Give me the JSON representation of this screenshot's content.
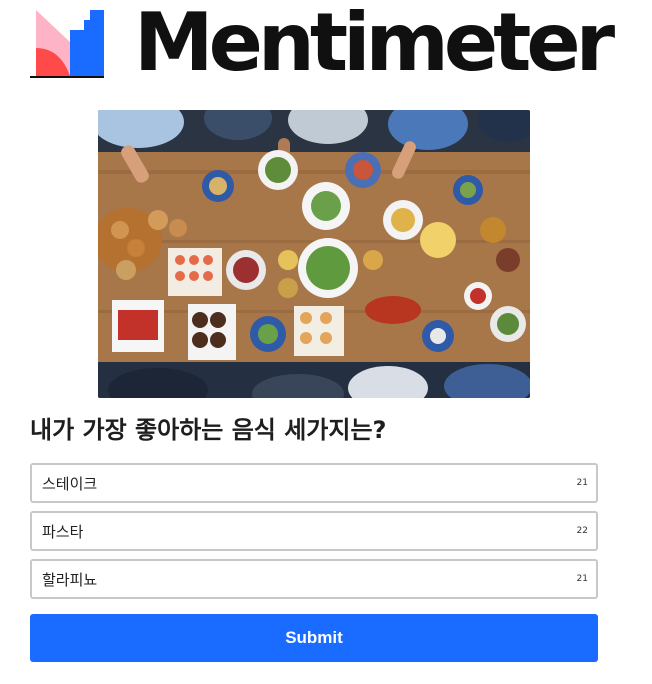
{
  "brand": {
    "name": "Mentimeter",
    "colors": {
      "pink": "#ffb3c7",
      "red": "#ff4a4a",
      "blue": "#196cff",
      "text": "#101010"
    }
  },
  "hero_image": {
    "icon": "food-table-photo"
  },
  "question": {
    "text": "내가 가장 좋아하는 음식 세가지는?"
  },
  "answers": [
    {
      "value": "스테이크",
      "remaining": "21"
    },
    {
      "value": "파스타",
      "remaining": "22"
    },
    {
      "value": "할라피뇨",
      "remaining": "21"
    }
  ],
  "submit": {
    "label": "Submit",
    "color": "#196cff"
  }
}
